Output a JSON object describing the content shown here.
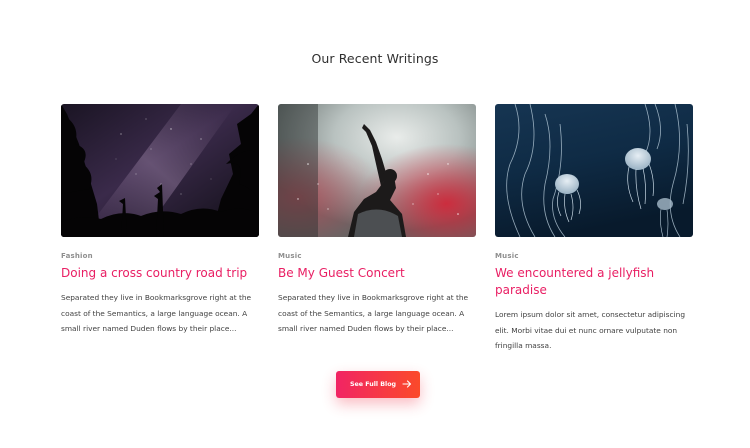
{
  "section": {
    "title": "Our Recent Writings"
  },
  "posts": [
    {
      "category": "Fashion",
      "title": "Doing a cross country road trip",
      "excerpt": "Separated they live in Bookmarksgrove right at the coast of the Semantics, a large language ocean. A small river named Duden flows by their place...",
      "image": "night-sky-milky-way-forest"
    },
    {
      "category": "Music",
      "title": "Be My Guest Concert",
      "excerpt": "Separated they live in Bookmarksgrove right at the coast of the Semantics, a large language ocean. A small river named Duden flows by their place...",
      "image": "concert-singer-raised-hand"
    },
    {
      "category": "Music",
      "title": "We encountered a jellyfish paradise",
      "excerpt": "Lorem ipsum dolor sit amet, consectetur adipiscing elit. Morbi vitae dui et nunc ornare vulputate non fringilla massa.",
      "image": "jellyfish-underwater"
    }
  ],
  "cta": {
    "label": "See Full Blog",
    "icon": "arrow-right-icon"
  },
  "colors": {
    "accent": "#e91e63",
    "button_gradient_start": "#f12464",
    "button_gradient_end": "#fb4a2a",
    "category_text": "#8f8f8f",
    "body_text": "#3f3f3f"
  }
}
